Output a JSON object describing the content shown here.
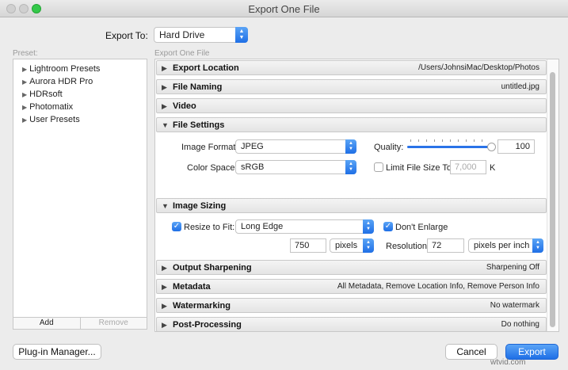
{
  "window": {
    "title": "Export One File"
  },
  "export_to": {
    "label": "Export To:",
    "value": "Hard Drive"
  },
  "preset_panel": {
    "label": "Preset:",
    "items": [
      "Lightroom Presets",
      "Aurora HDR Pro",
      "HDRsoft",
      "Photomatix",
      "User Presets"
    ],
    "add_label": "Add",
    "remove_label": "Remove"
  },
  "section_label": "Export One File",
  "sections": {
    "export_location": {
      "title": "Export Location",
      "value": "/Users/JohnsiMac/Desktop/Photos"
    },
    "file_naming": {
      "title": "File Naming",
      "value": "untitled.jpg"
    },
    "video": {
      "title": "Video"
    },
    "file_settings": {
      "title": "File Settings",
      "image_format_label": "Image Format:",
      "image_format_value": "JPEG",
      "quality_label": "Quality:",
      "quality_value": "100",
      "quality_level": 100,
      "color_space_label": "Color Space:",
      "color_space_value": "sRGB",
      "limit_label": "Limit File Size To:",
      "limit_placeholder": "7,000",
      "limit_unit": "K"
    },
    "image_sizing": {
      "title": "Image Sizing",
      "resize_label": "Resize to Fit:",
      "resize_value": "Long Edge",
      "dont_enlarge_label": "Don't Enlarge",
      "size_value": "750",
      "size_unit": "pixels",
      "resolution_label": "Resolution:",
      "resolution_value": "72",
      "resolution_unit": "pixels per inch"
    },
    "output_sharpening": {
      "title": "Output Sharpening",
      "value": "Sharpening Off"
    },
    "metadata": {
      "title": "Metadata",
      "value": "All Metadata, Remove Location Info, Remove Person Info"
    },
    "watermarking": {
      "title": "Watermarking",
      "value": "No watermark"
    },
    "post_processing": {
      "title": "Post-Processing",
      "value": "Do nothing"
    }
  },
  "buttons": {
    "plugin_manager": "Plug-in Manager...",
    "cancel": "Cancel",
    "export": "Export"
  },
  "watermark": "wtvid.com",
  "icons": {
    "collapsed": "triangle-right-icon",
    "expanded": "triangle-down-icon",
    "checkmark": "checkmark-icon"
  },
  "colors": {
    "accent": "#1f6fe6"
  }
}
